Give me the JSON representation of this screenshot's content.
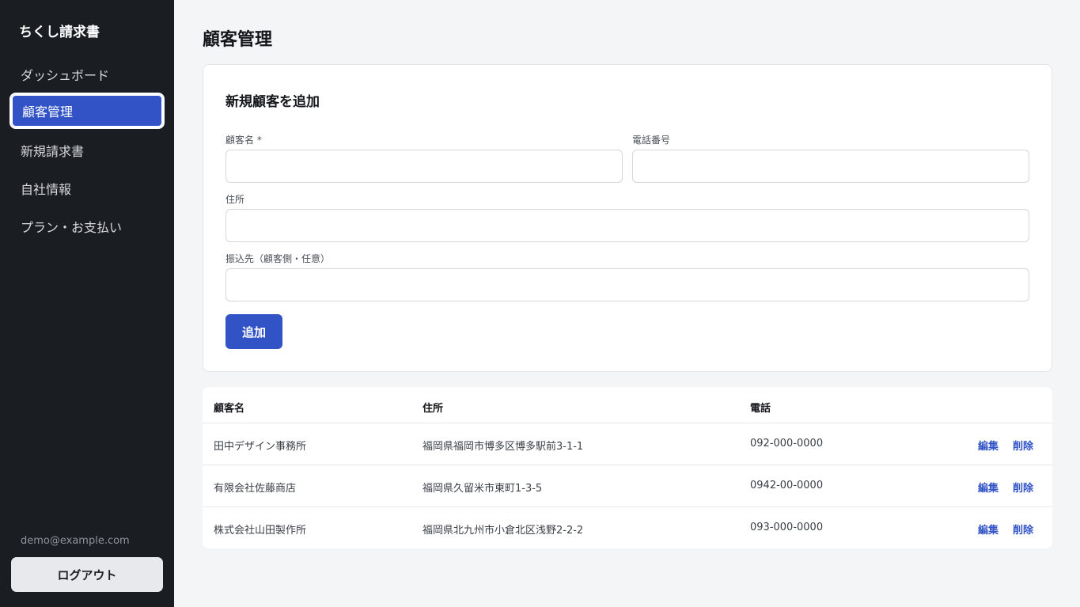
{
  "sidebar": {
    "brand": "ちくし請求書",
    "items": [
      {
        "label": "ダッシュボード"
      },
      {
        "label": "顧客管理"
      },
      {
        "label": "新規請求書"
      },
      {
        "label": "自社情報"
      },
      {
        "label": "プラン・お支払い"
      }
    ],
    "email": "demo@example.com",
    "logout_label": "ログアウト"
  },
  "main": {
    "title": "顧客管理",
    "form": {
      "title": "新規顧客を追加",
      "name_label": "顧客名 *",
      "phone_label": "電話番号",
      "address_label": "住所",
      "bank_label": "振込先（顧客側・任意）",
      "name_value": "",
      "phone_value": "",
      "address_value": "",
      "bank_value": "",
      "submit_label": "追加"
    },
    "table": {
      "headers": {
        "name": "顧客名",
        "address": "住所",
        "phone": "電話"
      },
      "rows": [
        {
          "name": "田中デザイン事務所",
          "address": "福岡県福岡市博多区博多駅前3-1-1",
          "phone": "092-000-0000",
          "edit": "編集",
          "delete": "削除"
        },
        {
          "name": "有限会社佐藤商店",
          "address": "福岡県久留米市東町1-3-5",
          "phone": "0942-00-0000",
          "edit": "編集",
          "delete": "削除"
        },
        {
          "name": "株式会社山田製作所",
          "address": "福岡県北九州市小倉北区浅野2-2-2",
          "phone": "093-000-0000",
          "edit": "編集",
          "delete": "削除"
        }
      ]
    }
  },
  "colors": {
    "accent": "#3153c6",
    "sidebar_bg": "#1a1d22",
    "page_bg": "#f4f5f7"
  }
}
